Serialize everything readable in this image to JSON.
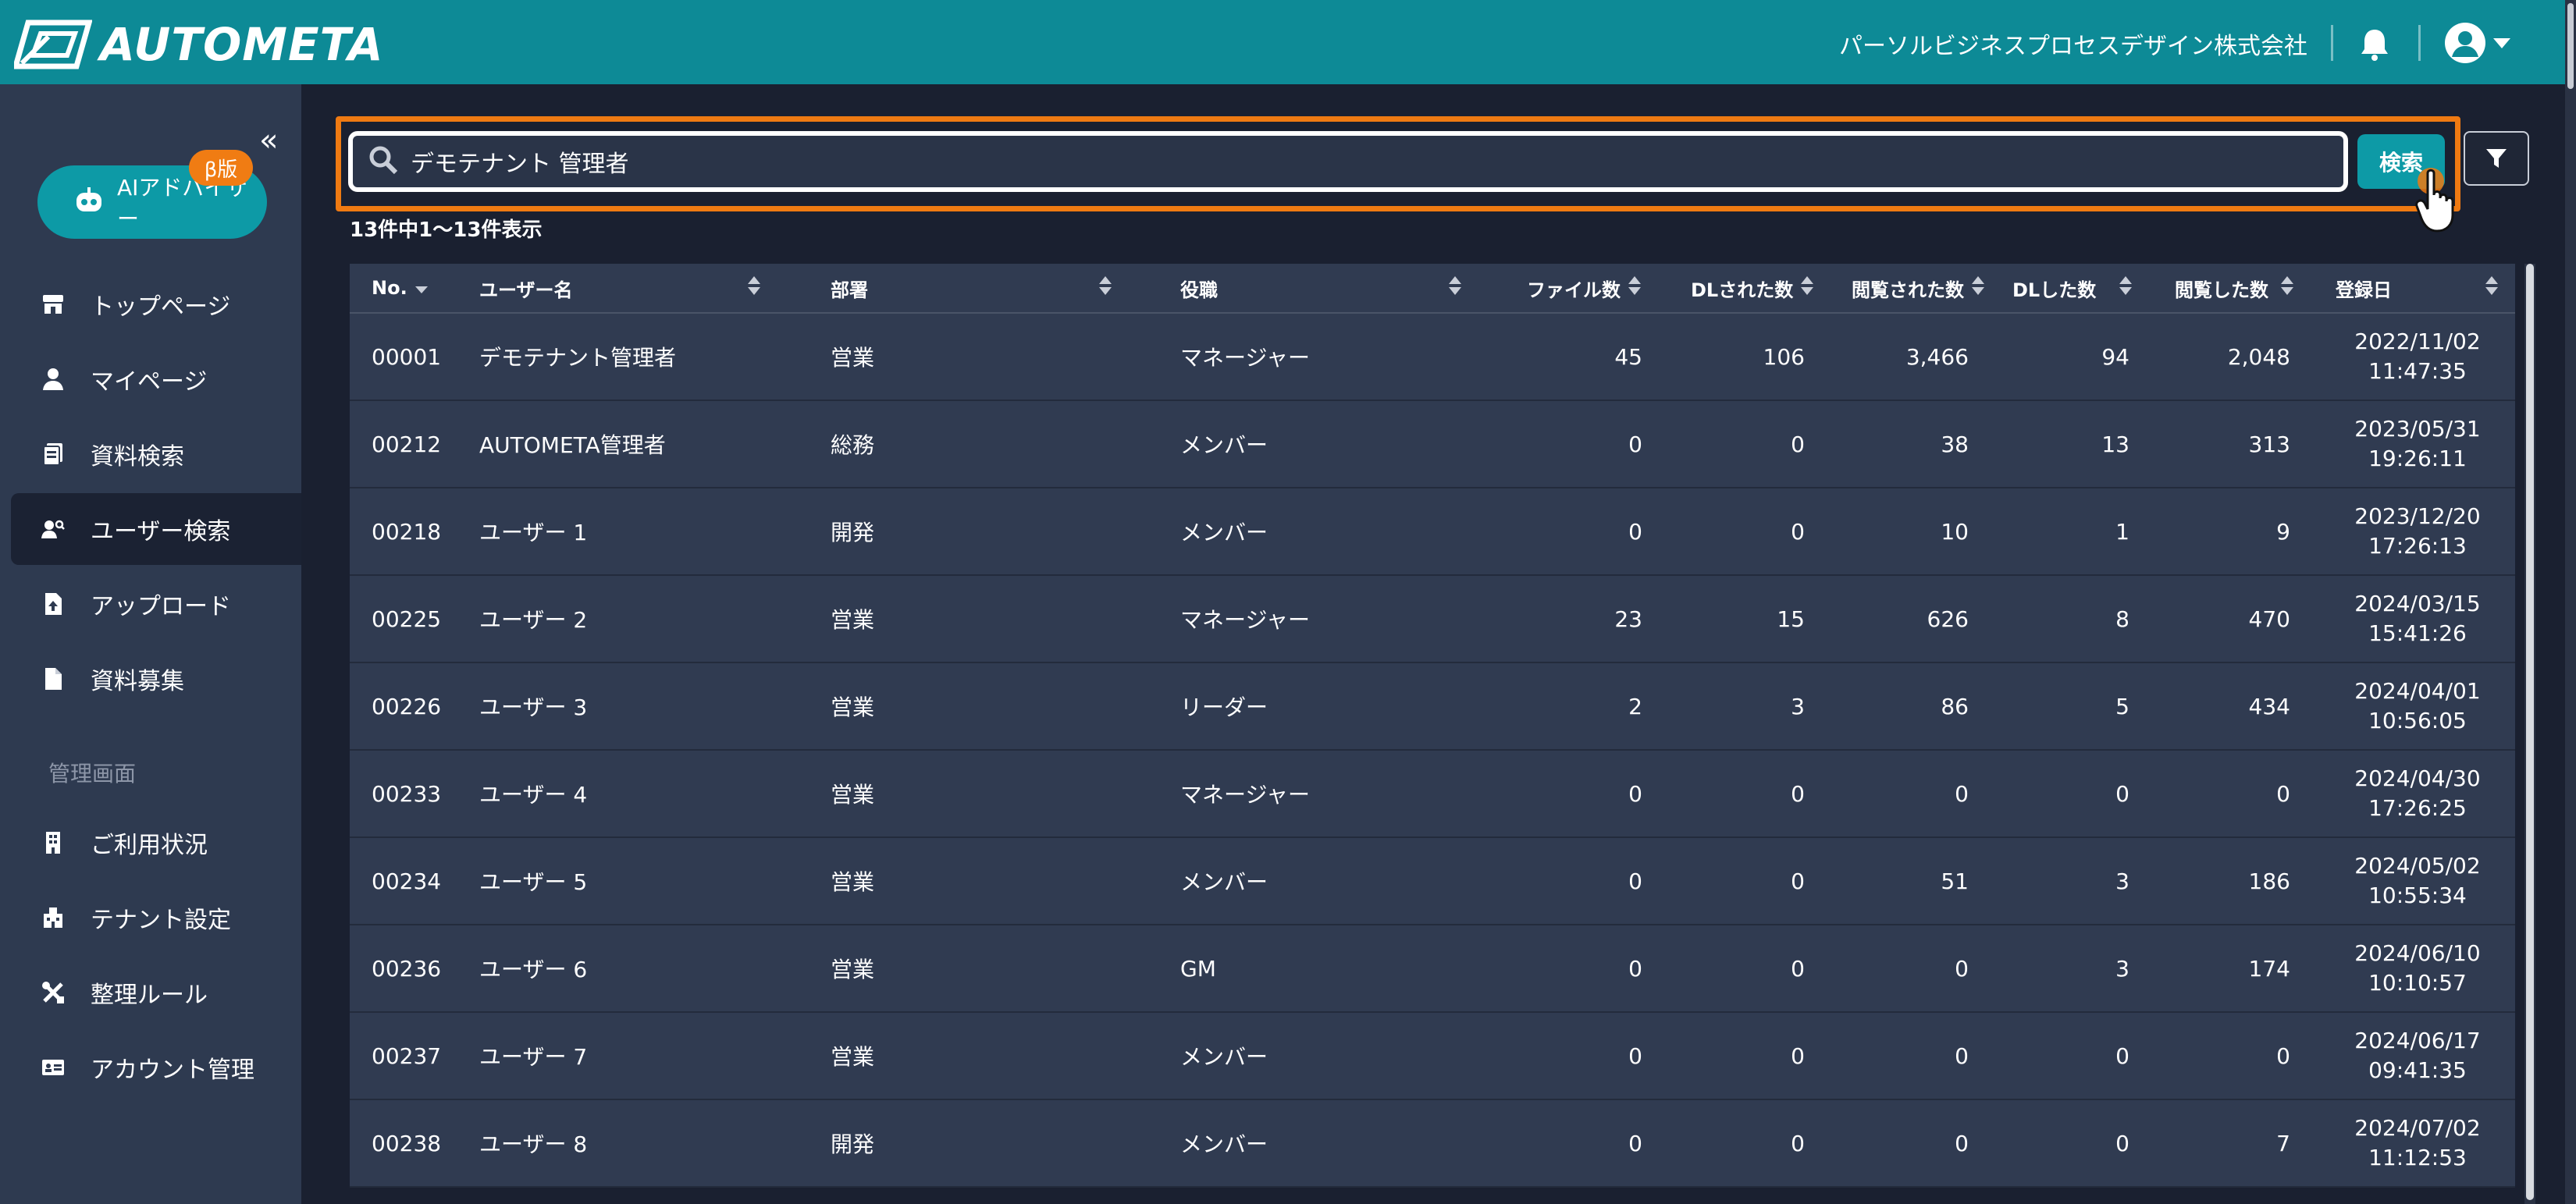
{
  "app": {
    "brand": "AUTOMETA",
    "company": "パーソルビジネスプロセスデザイン株式会社"
  },
  "sidebar": {
    "collapse_glyph": "«",
    "ai_button": {
      "label": "AIアドバイザー",
      "badge": "β版"
    },
    "items": [
      {
        "label": "トップページ",
        "icon": "store-icon"
      },
      {
        "label": "マイページ",
        "icon": "person-icon"
      },
      {
        "label": "資料検索",
        "icon": "document-search-icon"
      },
      {
        "label": "ユーザー検索",
        "icon": "user-search-icon",
        "active": true
      },
      {
        "label": "アップロード",
        "icon": "file-upload-icon"
      },
      {
        "label": "資料募集",
        "icon": "file-icon"
      }
    ],
    "admin_section_label": "管理画面",
    "admin_items": [
      {
        "label": "ご利用状況",
        "icon": "building-icon"
      },
      {
        "label": "テナント設定",
        "icon": "tenant-icon"
      },
      {
        "label": "整理ルール",
        "icon": "tools-icon"
      },
      {
        "label": "アカウント管理",
        "icon": "id-card-icon"
      }
    ]
  },
  "search": {
    "value": "デモテナント 管理者",
    "button_label": "検索"
  },
  "result_count": "13件中1〜13件表示",
  "table": {
    "columns": [
      "No.",
      "ユーザー名",
      "部署",
      "役職",
      "ファイル数",
      "DLされた数",
      "閲覧された数",
      "DLした数",
      "閲覧した数",
      "登録日"
    ],
    "rows": [
      {
        "no": "00001",
        "name": "デモテナント管理者",
        "dept": "営業",
        "role": "マネージャー",
        "files": "45",
        "dl_received": "106",
        "views_received": "3,466",
        "dl_made": "94",
        "views_made": "2,048",
        "date": "2022/11/02",
        "time": "11:47:35"
      },
      {
        "no": "00212",
        "name": "AUTOMETA管理者",
        "dept": "総務",
        "role": "メンバー",
        "files": "0",
        "dl_received": "0",
        "views_received": "38",
        "dl_made": "13",
        "views_made": "313",
        "date": "2023/05/31",
        "time": "19:26:11"
      },
      {
        "no": "00218",
        "name": "ユーザー 1",
        "dept": "開発",
        "role": "メンバー",
        "files": "0",
        "dl_received": "0",
        "views_received": "10",
        "dl_made": "1",
        "views_made": "9",
        "date": "2023/12/20",
        "time": "17:26:13"
      },
      {
        "no": "00225",
        "name": "ユーザー 2",
        "dept": "営業",
        "role": "マネージャー",
        "files": "23",
        "dl_received": "15",
        "views_received": "626",
        "dl_made": "8",
        "views_made": "470",
        "date": "2024/03/15",
        "time": "15:41:26"
      },
      {
        "no": "00226",
        "name": "ユーザー 3",
        "dept": "営業",
        "role": "リーダー",
        "files": "2",
        "dl_received": "3",
        "views_received": "86",
        "dl_made": "5",
        "views_made": "434",
        "date": "2024/04/01",
        "time": "10:56:05"
      },
      {
        "no": "00233",
        "name": "ユーザー 4",
        "dept": "営業",
        "role": "マネージャー",
        "files": "0",
        "dl_received": "0",
        "views_received": "0",
        "dl_made": "0",
        "views_made": "0",
        "date": "2024/04/30",
        "time": "17:26:25"
      },
      {
        "no": "00234",
        "name": "ユーザー 5",
        "dept": "営業",
        "role": "メンバー",
        "files": "0",
        "dl_received": "0",
        "views_received": "51",
        "dl_made": "3",
        "views_made": "186",
        "date": "2024/05/02",
        "time": "10:55:34"
      },
      {
        "no": "00236",
        "name": "ユーザー 6",
        "dept": "営業",
        "role": "GM",
        "files": "0",
        "dl_received": "0",
        "views_received": "0",
        "dl_made": "3",
        "views_made": "174",
        "date": "2024/06/10",
        "time": "10:10:57"
      },
      {
        "no": "00237",
        "name": "ユーザー 7",
        "dept": "営業",
        "role": "メンバー",
        "files": "0",
        "dl_received": "0",
        "views_received": "0",
        "dl_made": "0",
        "views_made": "0",
        "date": "2024/06/17",
        "time": "09:41:35"
      },
      {
        "no": "00238",
        "name": "ユーザー 8",
        "dept": "開発",
        "role": "メンバー",
        "files": "0",
        "dl_received": "0",
        "views_received": "0",
        "dl_made": "0",
        "views_made": "7",
        "date": "2024/07/02",
        "time": "11:12:53"
      }
    ]
  },
  "colors": {
    "header_bg": "#0d8a96",
    "accent": "#0d9aa6",
    "highlight": "#ef7a12",
    "sidebar_bg": "#2e3a50",
    "table_bg": "#303b51"
  }
}
